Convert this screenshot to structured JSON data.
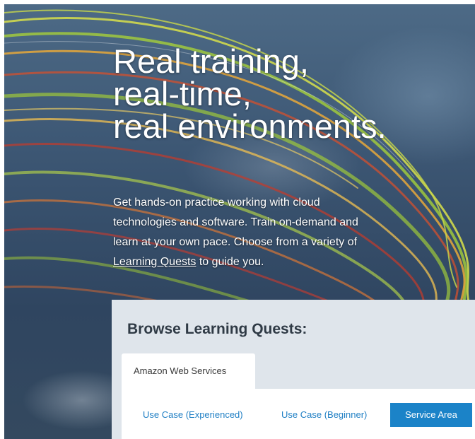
{
  "hero": {
    "headline": [
      "Real training,",
      "real-time,",
      "real environments."
    ],
    "intro_before_link": "Get hands-on practice working with cloud technologies and software. Train on-demand and learn at your own pace. Choose from a variety of ",
    "intro_link": "Learning Quests",
    "intro_after_link": " to guide you."
  },
  "quests": {
    "title": "Browse Learning Quests:",
    "tabs": [
      {
        "label": "Amazon Web Services",
        "active": true
      }
    ],
    "subtabs": [
      {
        "label": "Use Case (Experienced)",
        "active": false
      },
      {
        "label": "Use Case (Beginner)",
        "active": false
      },
      {
        "label": "Service Area",
        "active": true
      }
    ]
  },
  "colors": {
    "sky": "#3c5673",
    "panel": "#dfe5eb",
    "accent": "#1b83c8",
    "link": "#1f7fc4"
  }
}
